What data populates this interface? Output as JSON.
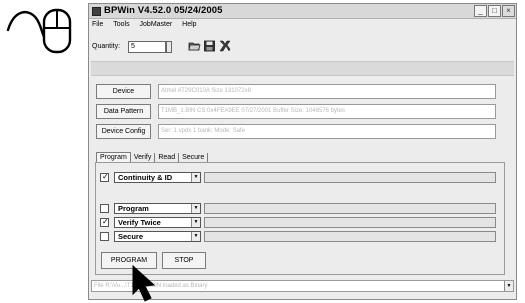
{
  "window": {
    "title": "BPWin  V4.52.0  05/24/2005",
    "min_glyph": "_",
    "max_glyph": "□",
    "close_glyph": "×"
  },
  "menu": [
    "File",
    "Tools",
    "JobMaster",
    "Help"
  ],
  "toolbar": {
    "quantity_label": "Quantity:",
    "quantity_value": "5"
  },
  "device_rows": [
    {
      "button": "Device",
      "info": "Atmel AT29C010A   Size 131072x8"
    },
    {
      "button": "Data Pattern",
      "info": "T1MB_1.BIN   CS:0x4FEA9EE  07/27/2001   Buffer Size: 1048576 bytes"
    },
    {
      "button": "Device Config",
      "info": "Ser: 1 vpdx 1 bank:   Mode: Safe"
    }
  ],
  "tabs": [
    "Program",
    "Verify",
    "Read",
    "Secure"
  ],
  "operations": [
    {
      "checked": true,
      "label": "Continuity & ID"
    },
    {
      "checked": false,
      "label": "Program"
    },
    {
      "checked": true,
      "label": "Verify Twice"
    },
    {
      "checked": false,
      "label": "Secure"
    }
  ],
  "actions": {
    "program": "PROGRAM",
    "stop": "STOP"
  },
  "status": {
    "text": "File R:\\Vu...\\T1MB_1.BIN loaded as Binary"
  }
}
